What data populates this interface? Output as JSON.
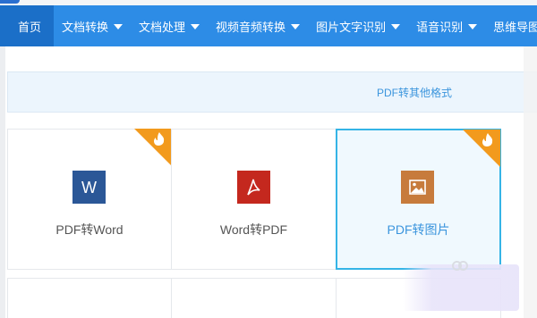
{
  "nav": {
    "items": [
      {
        "label": "首页",
        "active": true,
        "dropdown": false
      },
      {
        "label": "文档转换",
        "active": false,
        "dropdown": true
      },
      {
        "label": "文档处理",
        "active": false,
        "dropdown": true
      },
      {
        "label": "视频音频转换",
        "active": false,
        "dropdown": true
      },
      {
        "label": "图片文字识别",
        "active": false,
        "dropdown": true
      },
      {
        "label": "语音识别",
        "active": false,
        "dropdown": true
      },
      {
        "label": "思维导图",
        "active": false,
        "dropdown": true
      }
    ]
  },
  "format_bar": {
    "label": "PDF转其他格式"
  },
  "tools": [
    {
      "label": "PDF转Word",
      "icon": "word-icon",
      "icon_color": "#2b5797",
      "hot": true,
      "selected": false
    },
    {
      "label": "Word转PDF",
      "icon": "pdf-icon",
      "icon_color": "#c4281e",
      "hot": false,
      "selected": false
    },
    {
      "label": "PDF转图片",
      "icon": "image-icon",
      "icon_color": "#c77b3c",
      "hot": true,
      "selected": true
    }
  ],
  "colors": {
    "nav_bg": "#2d8ce6",
    "nav_active": "#1b6fc8",
    "accent_text": "#3b95dd",
    "selected_border": "#35b4e6",
    "hot_badge": "#f29a1d"
  }
}
